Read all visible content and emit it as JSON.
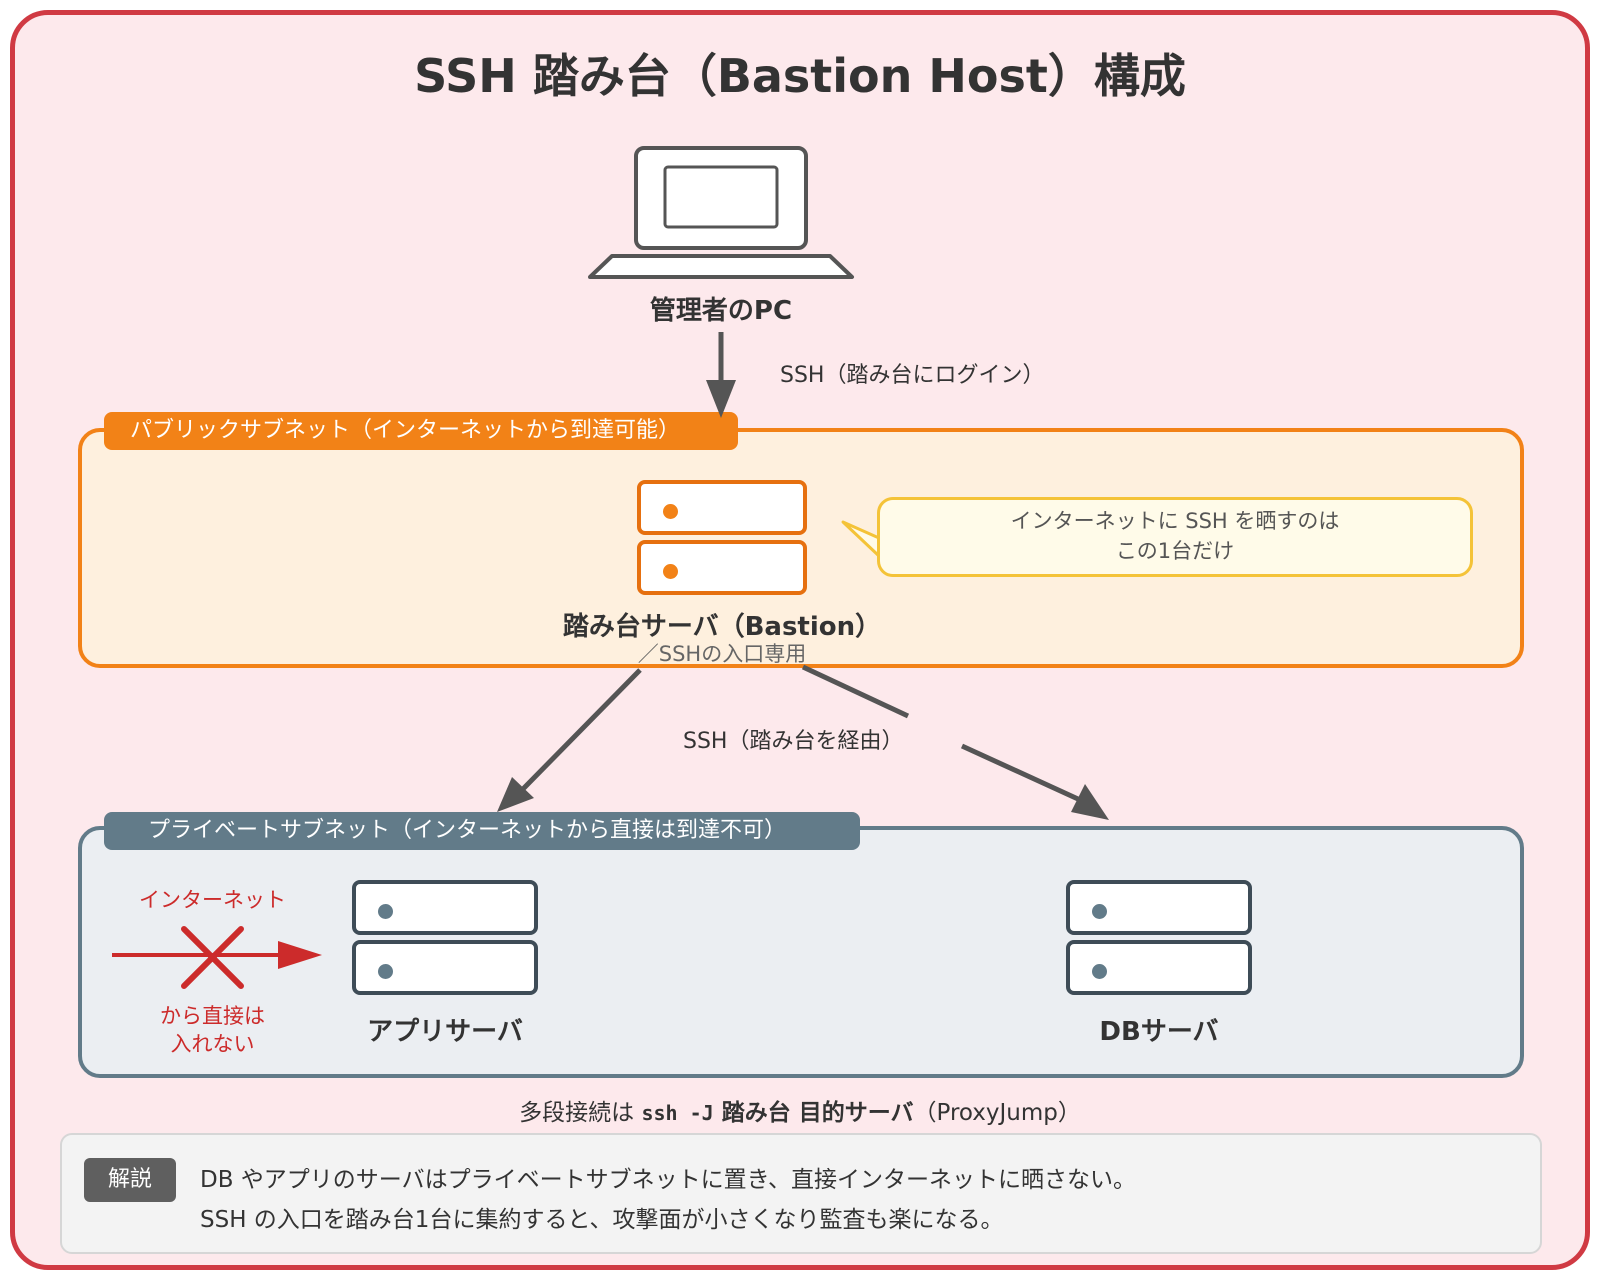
{
  "title": "SSH 踏み台（Bastion Host）構成",
  "admin_pc": {
    "label": "管理者のPC"
  },
  "edge_login": {
    "label": "SSH（踏み台にログイン）"
  },
  "public_subnet": {
    "label": "パブリックサブネット（インターネットから到達可能）"
  },
  "bastion": {
    "label": "踏み台サーバ（Bastion）",
    "sublabel": "／SSHの入口専用"
  },
  "callout": {
    "line1": "インターネットに SSH を晒すのは",
    "line2": "この1台だけ"
  },
  "edge_via": {
    "label": "SSH（踏み台を経由）"
  },
  "private_subnet": {
    "label": "プライベートサブネット（インターネットから直接は到達不可）"
  },
  "internet_blocked": {
    "label_top": "インターネット",
    "label_bottom_1": "から直接は",
    "label_bottom_2": "入れない"
  },
  "app_server": {
    "label": "アプリサーバ"
  },
  "db_server": {
    "label": "DBサーバ"
  },
  "proxyjump": {
    "prefix": "多段接続は ",
    "command": "ssh -J",
    "args": " 踏み台 目的サーバ",
    "suffix": "（ProxyJump）"
  },
  "explanation": {
    "badge": "解説",
    "line1": "DB やアプリのサーバはプライベートサブネットに置き、直接インターネットに晒さない。",
    "line2": "SSH の入口を踏み台1台に集約すると、攻撃面が小さくなり監査も楽になる。"
  },
  "colors": {
    "frame_border": "#d03a43",
    "frame_fill": "#fde9ec",
    "public_accent": "#f28217",
    "public_fill": "#fef0de",
    "private_accent": "#627b89",
    "private_fill": "#ebeef2",
    "callout_border": "#f4c338",
    "blocked_red": "#cc2b2b",
    "arrow_gray": "#555555"
  }
}
